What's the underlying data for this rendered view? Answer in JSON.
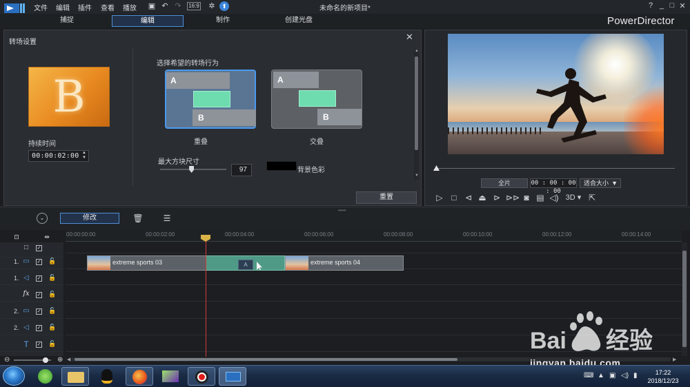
{
  "window": {
    "title": "未命名的新项目*",
    "brand": "PowerDirector",
    "menu": [
      "文件",
      "编辑",
      "插件",
      "查看",
      "播放"
    ],
    "controls": [
      "?",
      "_",
      "□",
      "✕"
    ]
  },
  "tabs": [
    {
      "label": "捕捉",
      "active": false
    },
    {
      "label": "编辑",
      "active": true
    },
    {
      "label": "制作",
      "active": false
    },
    {
      "label": "创建光盘",
      "active": false
    }
  ],
  "transition_panel": {
    "title": "转场设置",
    "preview_letter": "B",
    "duration_label": "持续时间",
    "duration_value": "00:00:02:00",
    "behavior_prompt": "选择希望的转场行为",
    "behaviors": [
      {
        "name": "重叠",
        "selected": true,
        "a": "A",
        "b": "B"
      },
      {
        "name": "交叠",
        "selected": false,
        "a": "A",
        "b": "B"
      }
    ],
    "block_size_label": "最大方块尺寸",
    "block_size_value": "97",
    "block_size_fraction": 0.47,
    "bg_color_label": "背景色彩",
    "bg_color": "#000000",
    "reset_label": "重置"
  },
  "preview": {
    "segment_label": "片段",
    "full_label": "全片",
    "timecode": "00 : 00 : 00 : 00",
    "fit_label": "适合大小",
    "mode_3d": "3D",
    "progress_fraction": 0
  },
  "timeline_toolbar": {
    "modify_label": "修改"
  },
  "timeline": {
    "ruler": [
      "00:00:00:00",
      "00:00:02:00",
      "00:00:04:00",
      "00:00:06:00",
      "00:00:08:00",
      "00:00:10:00",
      "00:00:12:00",
      "00:00:14:00"
    ],
    "tracks": [
      {
        "num": "",
        "kind": "master",
        "icon": "□"
      },
      {
        "num": "1.",
        "kind": "video",
        "icon": "▭"
      },
      {
        "num": "1.",
        "kind": "audio",
        "icon": "◁"
      },
      {
        "num": "",
        "kind": "fx",
        "icon": "fx"
      },
      {
        "num": "2.",
        "kind": "video",
        "icon": "▭"
      },
      {
        "num": "2.",
        "kind": "audio",
        "icon": "◁"
      },
      {
        "num": "",
        "kind": "title",
        "icon": "T"
      }
    ],
    "clips": [
      {
        "name": "extreme sports 03"
      },
      {
        "name": "extreme sports 04"
      }
    ],
    "transition_mark": "A"
  },
  "taskbar": {
    "time": "17:22",
    "date": "2018/12/23"
  },
  "watermark": {
    "text": "jingyan.baidu.com"
  }
}
